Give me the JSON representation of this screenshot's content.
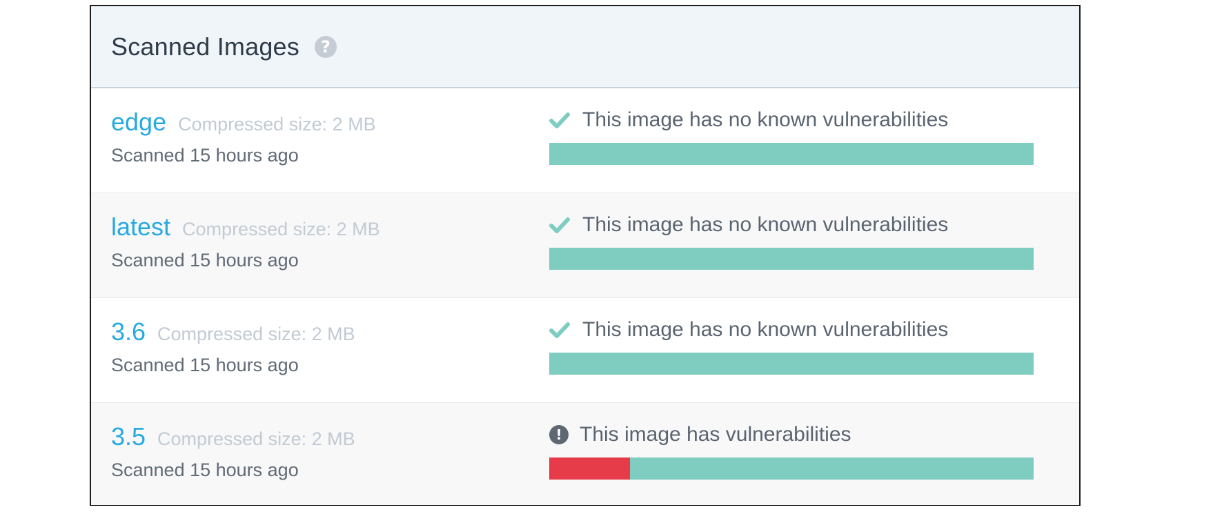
{
  "panel": {
    "title": "Scanned Images",
    "help_icon": "question-circle-icon",
    "help_symbol": "?"
  },
  "colors": {
    "safe": "#7ecdc0",
    "vulnerable": "#e63c4a",
    "tag": "#27a9e1"
  },
  "images": [
    {
      "tag": "edge",
      "size": "Compressed size: 2 MB",
      "scanned": "Scanned 15 hours ago",
      "status": "This image has no known vulnerabilities",
      "status_icon": "check-icon",
      "vulnerable_fraction": 0
    },
    {
      "tag": "latest",
      "size": "Compressed size: 2 MB",
      "scanned": "Scanned 15 hours ago",
      "status": "This image has no known vulnerabilities",
      "status_icon": "check-icon",
      "vulnerable_fraction": 0
    },
    {
      "tag": "3.6",
      "size": "Compressed size: 2 MB",
      "scanned": "Scanned 15 hours ago",
      "status": "This image has no known vulnerabilities",
      "status_icon": "check-icon",
      "vulnerable_fraction": 0
    },
    {
      "tag": "3.5",
      "size": "Compressed size: 2 MB",
      "scanned": "Scanned 15 hours ago",
      "status": "This image has vulnerabilities",
      "status_icon": "exclamation-circle-icon",
      "warn_symbol": "!",
      "vulnerable_fraction": 0.166
    }
  ]
}
